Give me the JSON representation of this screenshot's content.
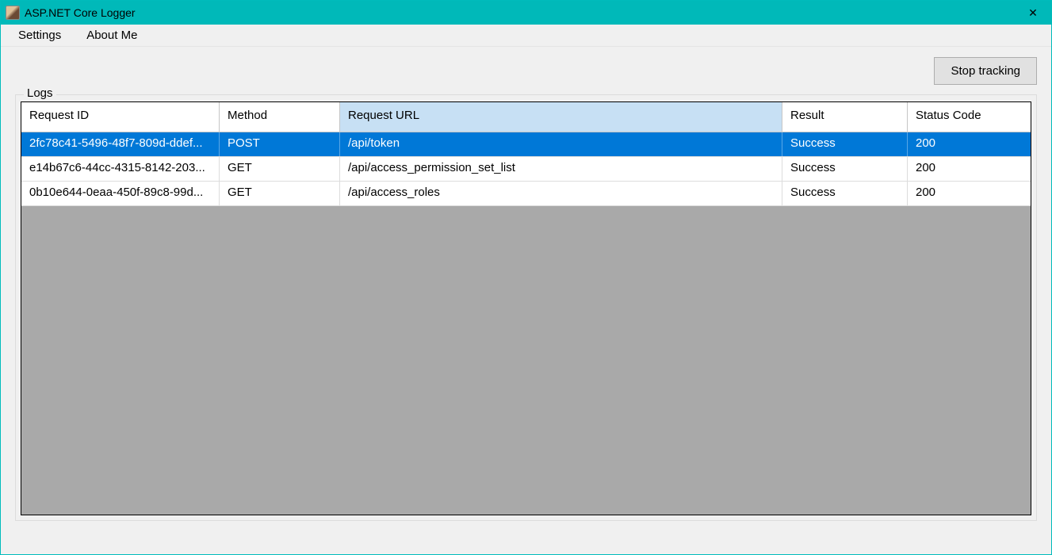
{
  "window": {
    "title": "ASP.NET Core Logger"
  },
  "menu": {
    "settings": "Settings",
    "about": "About Me"
  },
  "toolbar": {
    "stop_tracking": "Stop tracking"
  },
  "groupbox": {
    "label": "Logs"
  },
  "grid": {
    "columns": {
      "request_id": "Request ID",
      "method": "Method",
      "request_url": "Request URL",
      "result": "Result",
      "status_code": "Status Code"
    },
    "rows": [
      {
        "request_id": "2fc78c41-5496-48f7-809d-ddef...",
        "method": "POST",
        "request_url": "/api/token",
        "result": "Success",
        "status_code": "200",
        "selected": true
      },
      {
        "request_id": "e14b67c6-44cc-4315-8142-203...",
        "method": "GET",
        "request_url": "/api/access_permission_set_list",
        "result": "Success",
        "status_code": "200",
        "selected": false
      },
      {
        "request_id": "0b10e644-0eaa-450f-89c8-99d...",
        "method": "GET",
        "request_url": "/api/access_roles",
        "result": "Success",
        "status_code": "200",
        "selected": false
      }
    ]
  }
}
